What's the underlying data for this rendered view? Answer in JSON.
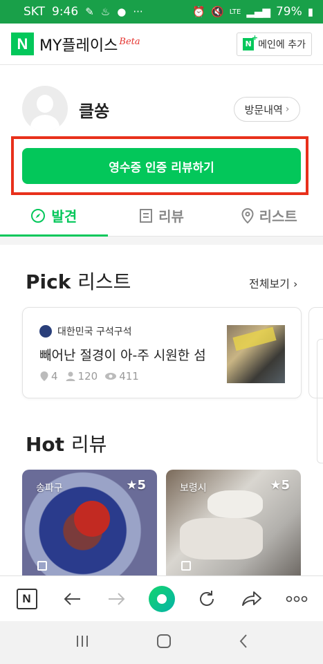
{
  "statusbar": {
    "carrier": "SKT",
    "time": "9:46",
    "battery": "79%",
    "signal": "LTE"
  },
  "appbar": {
    "logo": "N",
    "title": "MY플레이스",
    "beta": "Beta",
    "add_main_label": "메인에 추가"
  },
  "profile": {
    "username": "클쏭",
    "visits_label": "방문내역"
  },
  "review_button": {
    "label": "영수증 인증 리뷰하기"
  },
  "tabs": [
    {
      "label": "발견",
      "icon": "compass-icon",
      "active": true
    },
    {
      "label": "리뷰",
      "icon": "document-icon",
      "active": false
    },
    {
      "label": "리스트",
      "icon": "location-pin-icon",
      "active": false
    }
  ],
  "pick_section": {
    "title_en": "Pick",
    "title_ko": "리스트",
    "view_all": "전체보기",
    "card": {
      "author": "대한민국 구석구석",
      "title": "빼어난 절경이 아-주 시원한 섬",
      "places": "4",
      "followers": "120",
      "views": "411"
    }
  },
  "hot_section": {
    "title_en": "Hot",
    "title_ko": "리뷰",
    "cards": [
      {
        "region": "송파구",
        "rating": "5"
      },
      {
        "region": "보령시",
        "rating": "5"
      }
    ]
  },
  "colors": {
    "accent": "#03c75a",
    "status_green": "#19a049",
    "highlight_red": "#e8301b"
  }
}
